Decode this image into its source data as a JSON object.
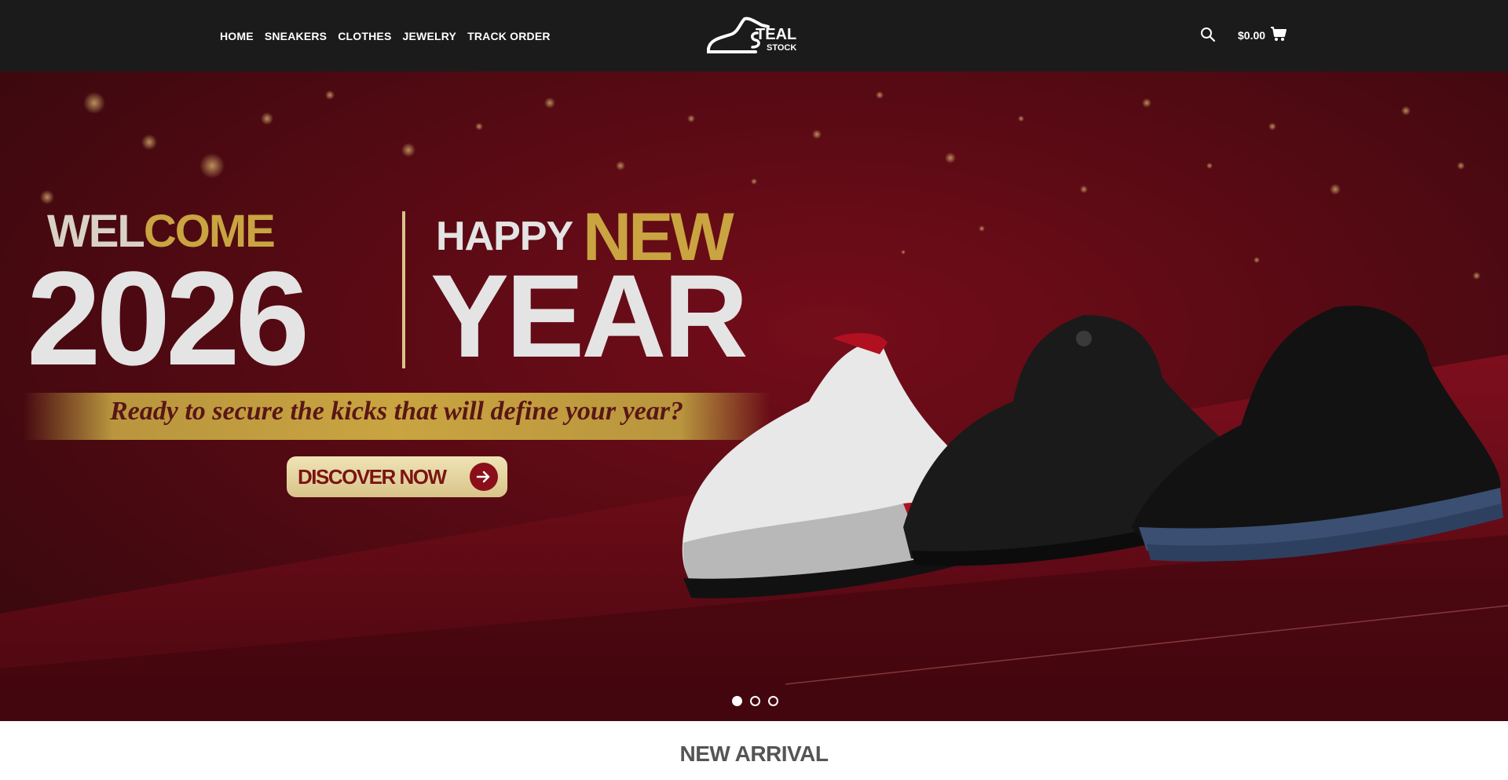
{
  "header": {
    "nav": [
      {
        "label": "HOME"
      },
      {
        "label": "SNEAKERS"
      },
      {
        "label": "CLOTHES"
      },
      {
        "label": "JEWELRY"
      },
      {
        "label": "TRACK ORDER"
      }
    ],
    "logo_text": "STEAL STOCK",
    "search_icon": "search-icon",
    "cart_total": "$0.00",
    "cart_icon": "cart-icon"
  },
  "hero": {
    "welcome_part1": "WEL",
    "welcome_part2": "COME",
    "year_number": "2026",
    "happy": "HAPPY",
    "new": "NEW",
    "year_word": "YEAR",
    "tagline": "Ready to secure the kicks that will define your year?",
    "cta_label": "DISCOVER NOW",
    "slides": 3,
    "active_slide": 1
  },
  "section": {
    "title": "NEW ARRIVAL"
  },
  "colors": {
    "header_bg": "#1b1b1b",
    "hero_red": "#8e1020",
    "gold": "#c9a441"
  }
}
